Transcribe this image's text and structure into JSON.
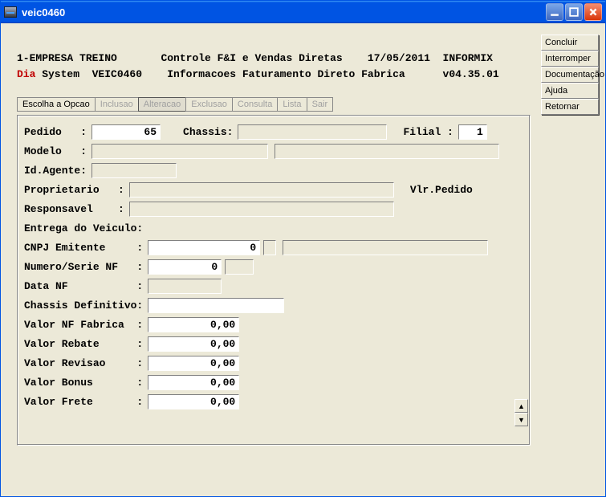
{
  "window": {
    "title": "veic0460"
  },
  "header": {
    "line1_left": "1-EMPRESA TREINO",
    "line1_center": "Controle F&I e Vendas Diretas",
    "line1_date": "17/05/2011",
    "line1_db": "INFORMIX",
    "line2_dia": "Dia",
    "line2_system": " System  VEIC0460",
    "line2_center": "Informacoes Faturamento Direto Fabrica",
    "line2_ver": "v04.35.01"
  },
  "menu": {
    "items": [
      {
        "label": "Escolha a Opcao",
        "first": true
      },
      {
        "label": "Inclusao"
      },
      {
        "label": "Alteracao",
        "selected": true
      },
      {
        "label": "Exclusao"
      },
      {
        "label": "Consulta"
      },
      {
        "label": "Lista"
      },
      {
        "label": "Sair"
      }
    ]
  },
  "form": {
    "pedido_label": "Pedido   :",
    "pedido_value": "65",
    "chassis_label": "Chassis:",
    "filial_label": "Filial :",
    "filial_value": "1",
    "modelo_label": "Modelo   :",
    "idagente_label": "Id.Agente:",
    "proprietario_label": "Proprietario   :",
    "vlrpedido_label": "Vlr.Pedido",
    "responsavel_label": "Responsavel    :",
    "entrega_label": "Entrega do Veiculo:",
    "cnpj_label": "CNPJ Emitente     :",
    "cnpj_value": "0",
    "numserie_label": "Numero/Serie NF   :",
    "numserie_value": "0",
    "datanf_label": "Data NF           :",
    "chassisdef_label": "Chassis Definitivo:",
    "valornf_label": "Valor NF Fabrica  :",
    "valornf_value": "0,00",
    "valorrebate_label": "Valor Rebate      :",
    "valorrebate_value": "0,00",
    "valorrevisao_label": "Valor Revisao     :",
    "valorrevisao_value": "0,00",
    "valorbonus_label": "Valor Bonus       :",
    "valorbonus_value": "0,00",
    "valorfrete_label": "Valor Frete       :",
    "valorfrete_value": "0,00"
  },
  "side": {
    "buttons": [
      "Concluir",
      "Interromper",
      "Documentação",
      "Ajuda",
      "Retornar"
    ]
  }
}
